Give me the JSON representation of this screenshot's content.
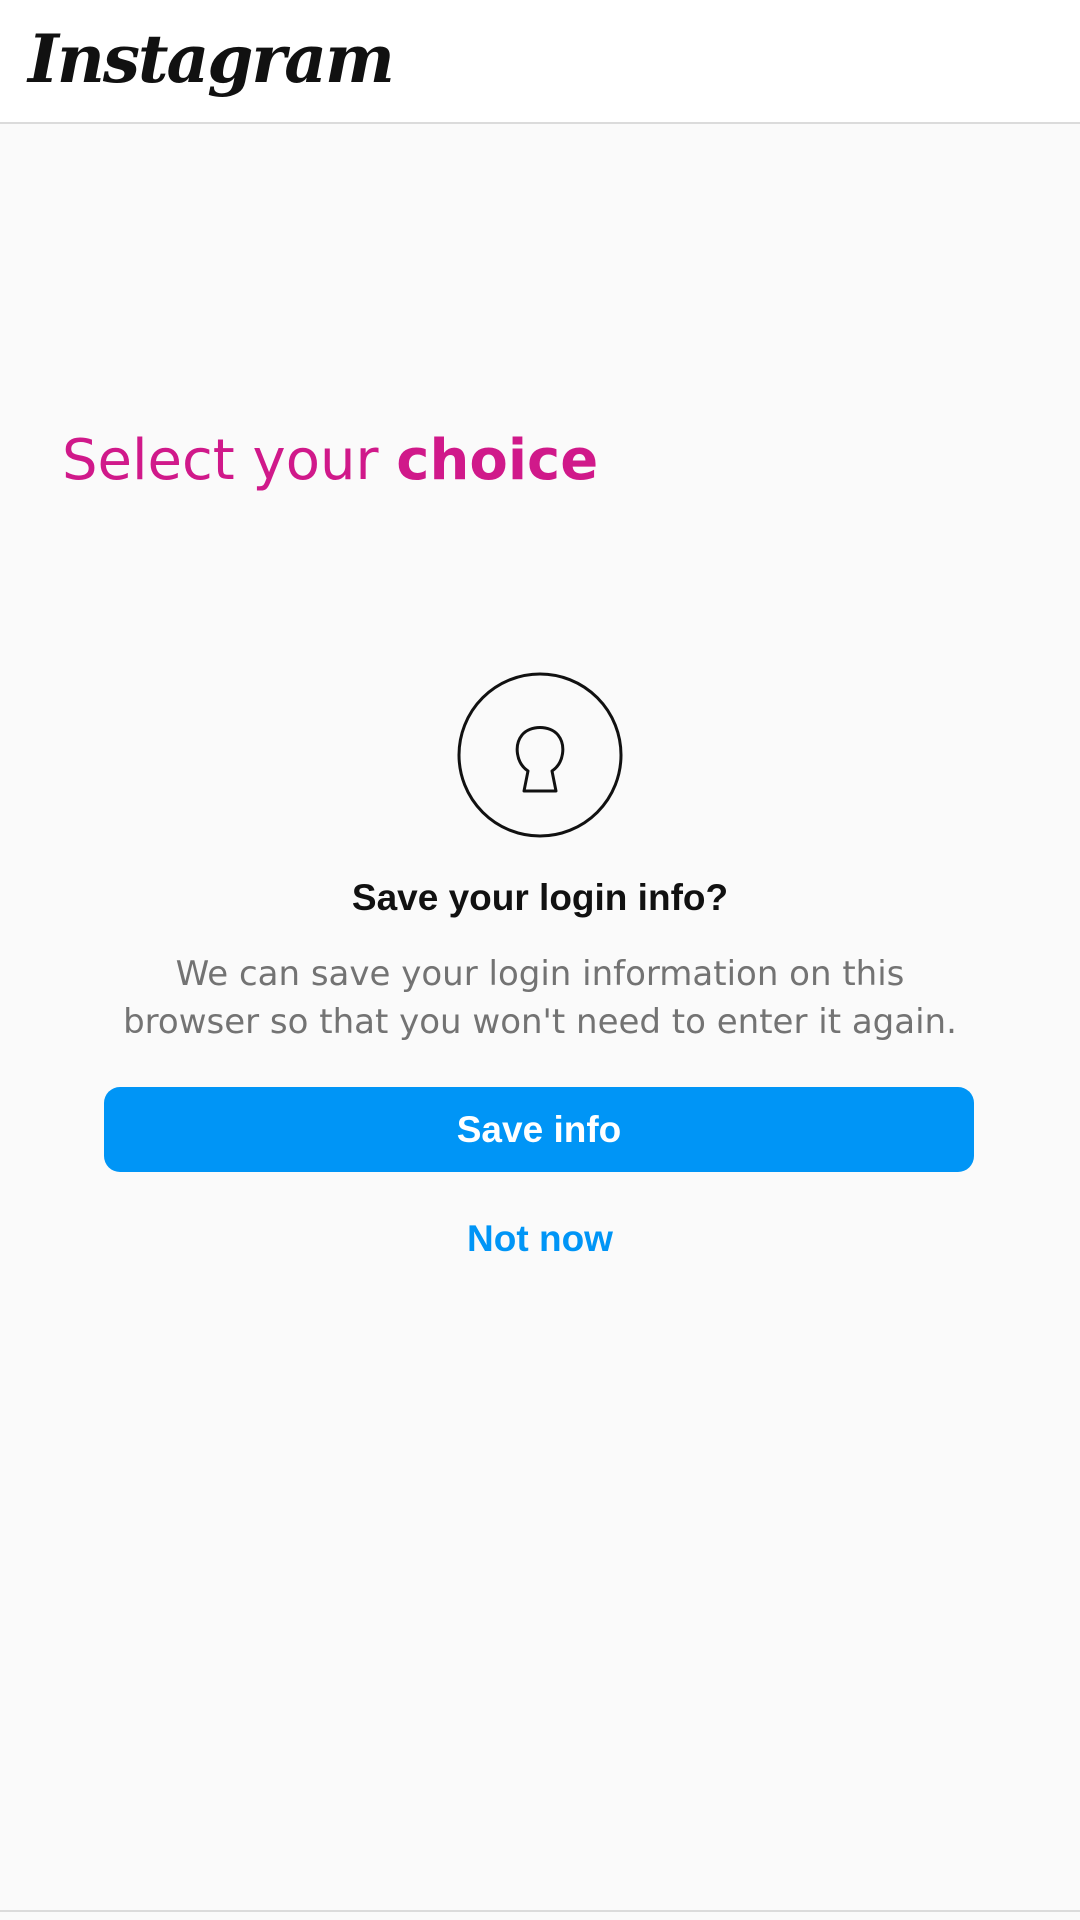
{
  "header": {
    "logo_text": "Instagram"
  },
  "headline": {
    "normal": "Select your ",
    "bold": "choice"
  },
  "dialog": {
    "icon": "keyhole-lock-icon",
    "title": "Save your login info?",
    "body_line1": "We can save your login information on this",
    "body_line2": "browser so that you won't need to enter it again.",
    "primary_label": "Save info",
    "secondary_label": "Not now"
  },
  "colors": {
    "accent_blue": "#0095f6",
    "headline_pink": "#d0198a",
    "body_gray": "#737373",
    "background": "#fafafa"
  }
}
